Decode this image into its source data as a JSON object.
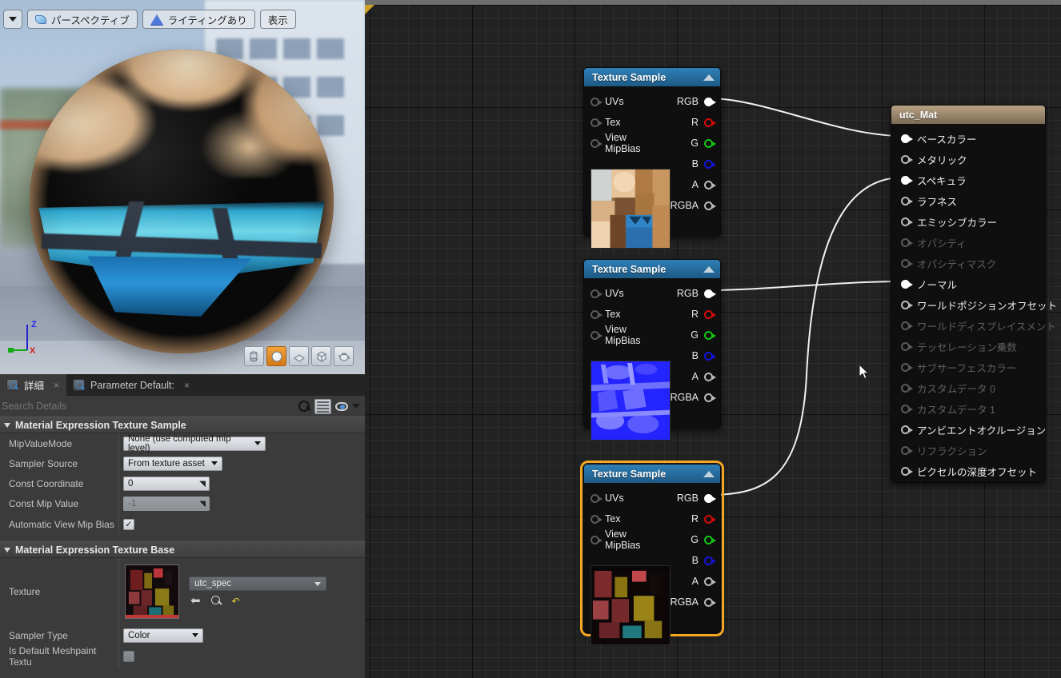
{
  "viewport": {
    "toolbar": {
      "menu_arrow": "▼",
      "view_mode": "パースペクティブ",
      "lighting": "ライティングあり",
      "show": "表示"
    },
    "axis": {
      "z": "Z",
      "x": "X"
    },
    "primitives": [
      {
        "name": "cylinder",
        "active": false
      },
      {
        "name": "sphere",
        "active": true
      },
      {
        "name": "plane",
        "active": false
      },
      {
        "name": "cube",
        "active": false
      },
      {
        "name": "teapot",
        "active": false
      }
    ]
  },
  "details": {
    "tabs": [
      {
        "label": "詳細",
        "active": true,
        "close": "×"
      },
      {
        "label": "Parameter Default:",
        "active": false,
        "close": "×"
      }
    ],
    "search_placeholder": "Search Details",
    "search_value": "",
    "sections": [
      {
        "title": "Material Expression Texture Sample",
        "rows": [
          {
            "label": "MipValueMode",
            "type": "combo",
            "value": "None (use computed mip level)"
          },
          {
            "label": "Sampler Source",
            "type": "combo",
            "value": "From texture asset"
          },
          {
            "label": "Const Coordinate",
            "type": "number",
            "value": "0",
            "disabled": false
          },
          {
            "label": "Const Mip Value",
            "type": "number",
            "value": "-1",
            "disabled": true
          },
          {
            "label": "Automatic View Mip Bias",
            "type": "check",
            "checked": true
          }
        ]
      },
      {
        "title": "Material Expression Texture Base",
        "rows": [
          {
            "label": "Texture",
            "type": "asset",
            "value": "utc_spec"
          },
          {
            "label": "Sampler Type",
            "type": "combo",
            "value": "Color"
          },
          {
            "label": "Is Default Meshpaint Textu",
            "type": "check",
            "checked": false
          }
        ]
      }
    ]
  },
  "graph": {
    "nodes": [
      {
        "id": "tex_basecolor",
        "title": "Texture Sample",
        "selected": false,
        "inputs": [
          "UVs",
          "Tex",
          "View MipBias"
        ],
        "outputs": [
          "RGB",
          "R",
          "G",
          "B",
          "A",
          "RGBA"
        ],
        "thumb": "basecolor"
      },
      {
        "id": "tex_normal",
        "title": "Texture Sample",
        "selected": false,
        "inputs": [
          "UVs",
          "Tex",
          "View MipBias"
        ],
        "outputs": [
          "RGB",
          "R",
          "G",
          "B",
          "A",
          "RGBA"
        ],
        "thumb": "normal"
      },
      {
        "id": "tex_spec",
        "title": "Texture Sample",
        "selected": true,
        "inputs": [
          "UVs",
          "Tex",
          "View MipBias"
        ],
        "outputs": [
          "RGB",
          "R",
          "G",
          "B",
          "A",
          "RGBA"
        ],
        "thumb": "spec"
      }
    ],
    "material_node": {
      "title": "utc_Mat",
      "outputs": [
        {
          "label": "ベースカラー",
          "enabled": true,
          "connected": true
        },
        {
          "label": "メタリック",
          "enabled": true,
          "connected": false
        },
        {
          "label": "スペキュラ",
          "enabled": true,
          "connected": true
        },
        {
          "label": "ラフネス",
          "enabled": true,
          "connected": false
        },
        {
          "label": "エミッシブカラー",
          "enabled": true,
          "connected": false
        },
        {
          "label": "オパシティ",
          "enabled": false,
          "connected": false
        },
        {
          "label": "オパシティマスク",
          "enabled": false,
          "connected": false
        },
        {
          "label": "ノーマル",
          "enabled": true,
          "connected": true
        },
        {
          "label": "ワールドポジションオフセット",
          "enabled": true,
          "connected": false
        },
        {
          "label": "ワールドディスプレイスメント",
          "enabled": false,
          "connected": false
        },
        {
          "label": "テッセレーション乗数",
          "enabled": false,
          "connected": false
        },
        {
          "label": "サブサーフェスカラー",
          "enabled": false,
          "connected": false
        },
        {
          "label": "カスタムデータ 0",
          "enabled": false,
          "connected": false
        },
        {
          "label": "カスタムデータ 1",
          "enabled": false,
          "connected": false
        },
        {
          "label": "アンビエントオクルージョン",
          "enabled": true,
          "connected": false
        },
        {
          "label": "リフラクション",
          "enabled": false,
          "connected": false
        },
        {
          "label": "ピクセルの深度オフセット",
          "enabled": true,
          "connected": false
        }
      ]
    }
  },
  "colors": {
    "node_header_start": "#2f7fb5",
    "node_header_end": "#1d5a86",
    "material_header_start": "#b8a285",
    "selection": "#f5a623",
    "pin_red": "#d40c0c",
    "pin_green": "#13c713",
    "pin_blue": "#1414d8",
    "graph_bg": "#222222",
    "panel_bg": "#3b3b3b"
  }
}
